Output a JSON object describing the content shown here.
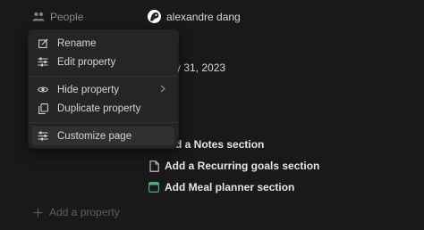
{
  "properties": {
    "people": {
      "label": "People",
      "icon": "people-icon",
      "value": "alexandre dang"
    },
    "date": {
      "value_partial": "y 31, 2023"
    },
    "add_property_label": "Add a property"
  },
  "template_buttons": [
    {
      "label_partial": "d a Notes section",
      "icon": "page-icon"
    },
    {
      "label": "Add a Recurring goals section",
      "icon": "page-icon"
    },
    {
      "label": "Add Meal planner section",
      "icon": "calendar-icon",
      "icon_color": "#4dab7a"
    }
  ],
  "context_menu": {
    "items": [
      {
        "label": "Rename",
        "icon": "rename-icon"
      },
      {
        "label": "Edit property",
        "icon": "sliders-icon"
      },
      {
        "label": "Hide property",
        "icon": "eye-icon",
        "has_submenu": true
      },
      {
        "label": "Duplicate property",
        "icon": "duplicate-icon"
      },
      {
        "label": "Customize page",
        "icon": "sliders-icon",
        "highlighted": true
      }
    ]
  },
  "colors": {
    "background": "#191919",
    "menu_background": "#252525",
    "menu_highlight": "#303030",
    "muted_text": "#8a8a8a",
    "calendar_green": "#4dab7a"
  }
}
